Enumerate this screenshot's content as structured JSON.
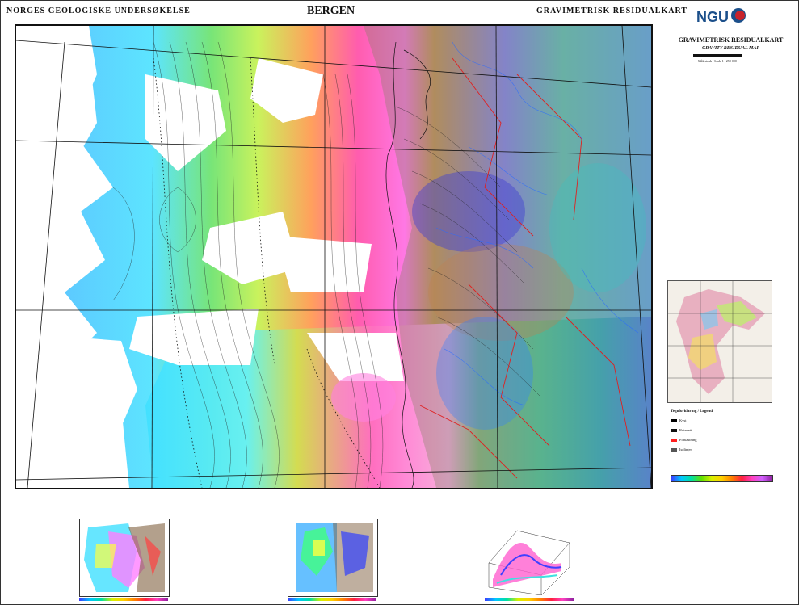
{
  "header": {
    "left": "NORGES GEOLOGISKE UNDERSØKELSE",
    "center": "BERGEN",
    "right": "GRAVIMETRISK RESIDUALKART"
  },
  "logo": {
    "text": "NGU"
  },
  "side": {
    "title": "GRAVIMETRISK RESIDUALKART",
    "subtitle": "GRAVITY RESIDUAL MAP",
    "scale": "Målestokk / Scale 1 : 250 000",
    "legend_title": "Tegnforklaring / Legend",
    "legend": [
      {
        "label": "Kyst",
        "color": "#000000"
      },
      {
        "label": "Rutenett",
        "color": "#111111"
      },
      {
        "label": "Forkastning",
        "color": "#ff2020"
      },
      {
        "label": "Isolinjer",
        "color": "#555555"
      }
    ]
  },
  "colors": {
    "frame": "#111111",
    "fault": "#e02020",
    "contour": "#222222",
    "blue_water": "#3070ff"
  }
}
